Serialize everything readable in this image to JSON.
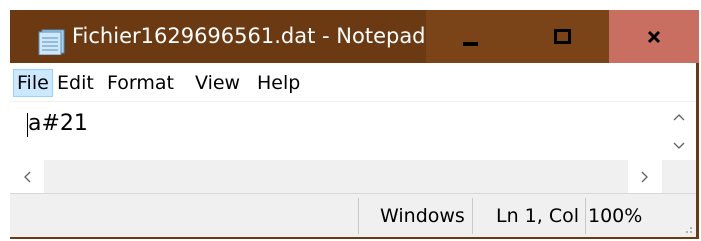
{
  "window": {
    "title": "Fichier1629696561.dat - Notepad",
    "icons": {
      "app": "notepad-icon",
      "minimize": "minimize-icon",
      "maximize": "maximize-icon",
      "close": "close-icon"
    },
    "colors": {
      "titlebar": "#6b3a12",
      "close_bg": "#c86f62"
    }
  },
  "menu": {
    "items": [
      {
        "label": "File"
      },
      {
        "label": "Edit"
      },
      {
        "label": "Format"
      },
      {
        "label": "View"
      },
      {
        "label": "Help"
      }
    ]
  },
  "editor": {
    "content": "a#21"
  },
  "scrollbars": {
    "up": "^",
    "down": "v",
    "left": "<",
    "right": ">"
  },
  "status": {
    "encoding": "Windows",
    "position": "Ln 1, Col",
    "zoom": "100%"
  }
}
